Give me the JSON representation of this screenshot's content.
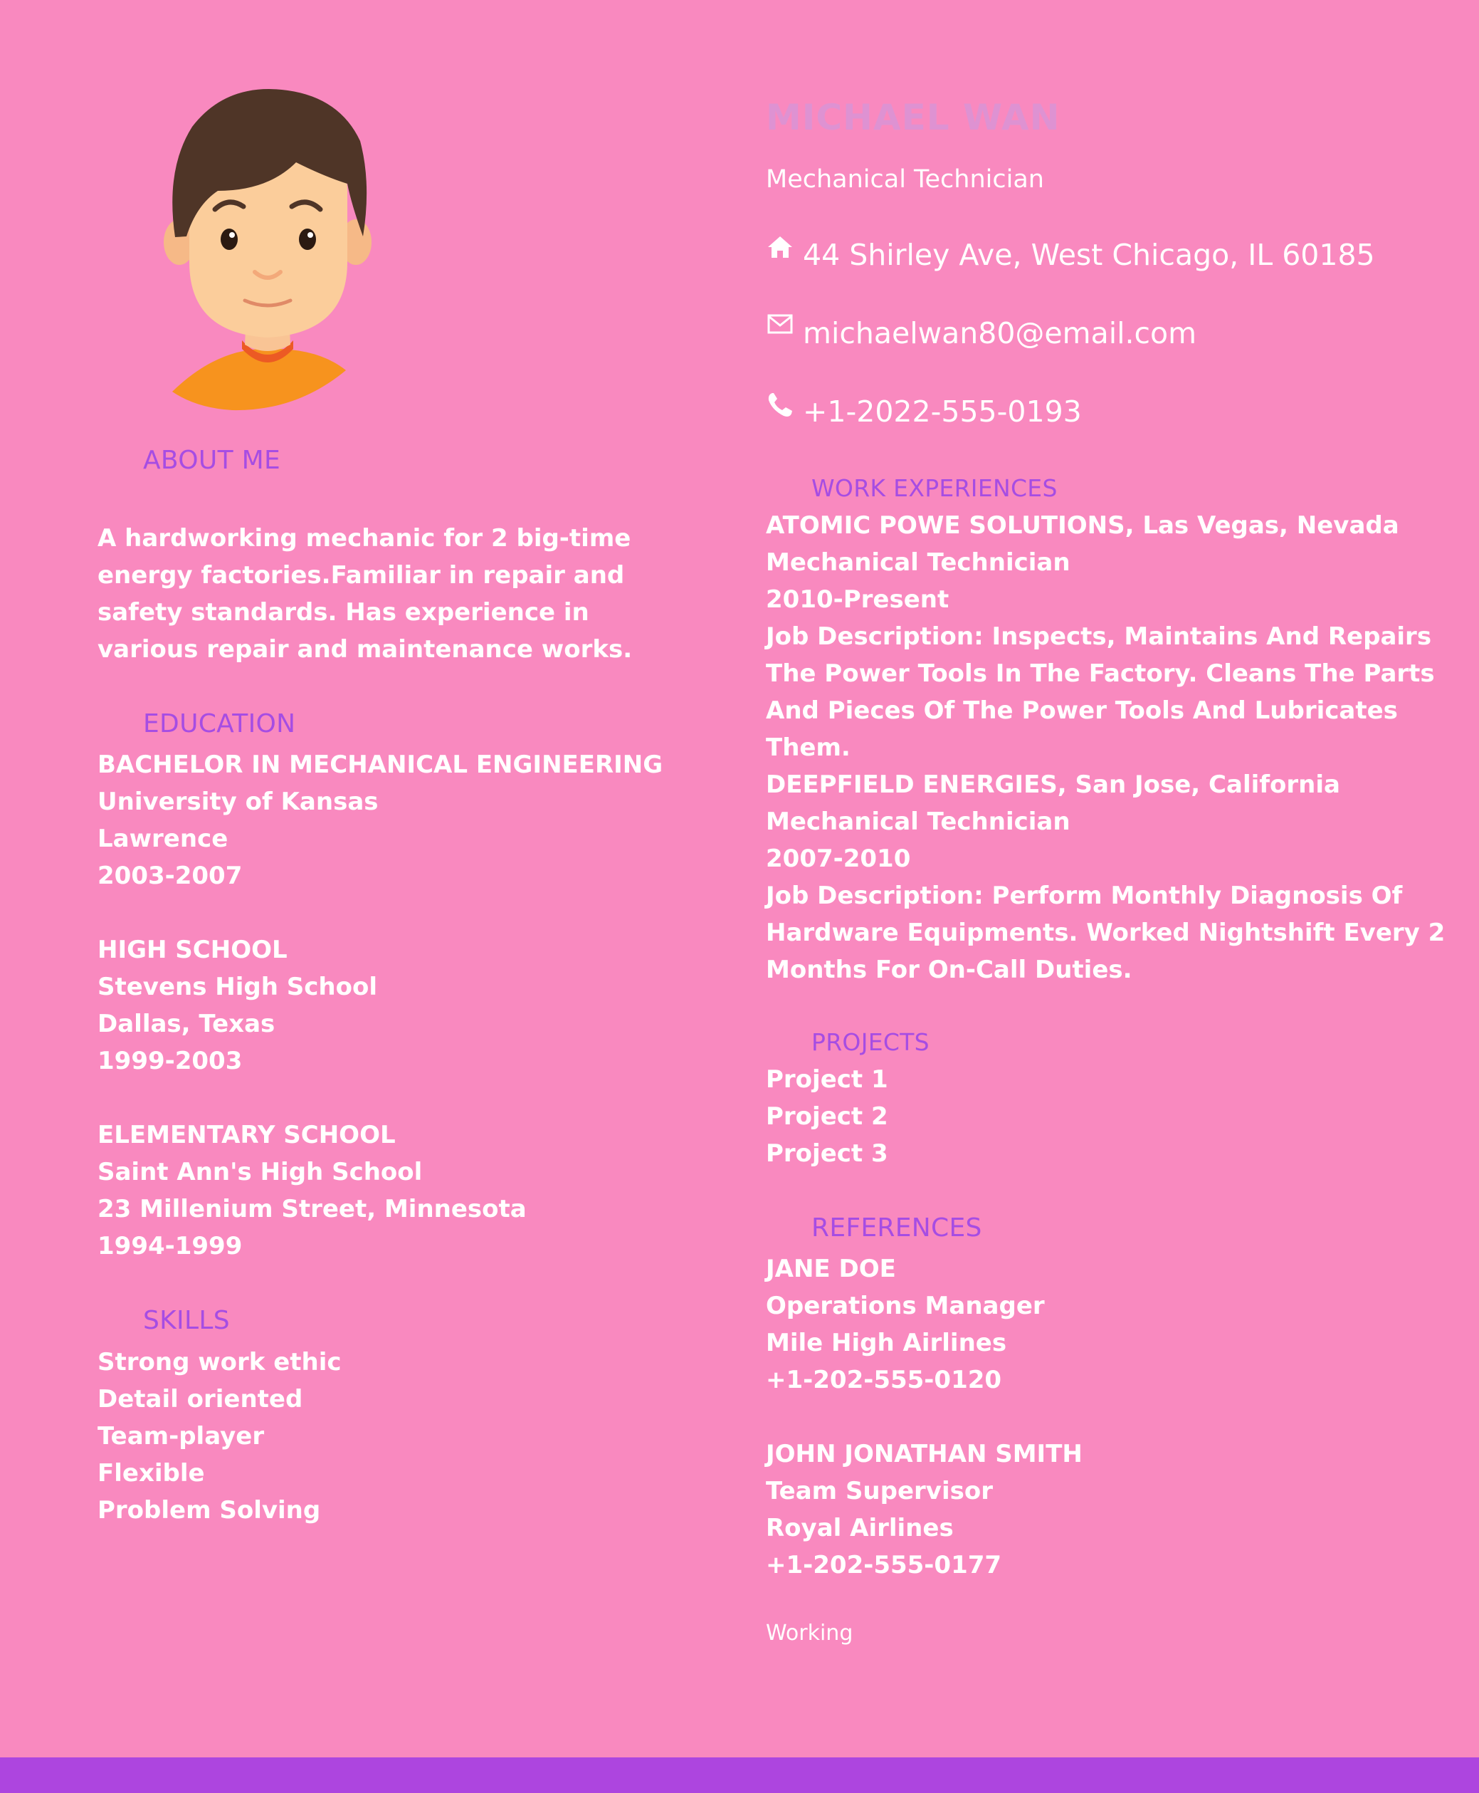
{
  "name": "MICHAEL WAN",
  "title": "Mechanical Technician",
  "contact": {
    "address": "44 Shirley Ave, West Chicago, IL 60185",
    "email": "michaelwan80@email.com",
    "phone": "+1-2022-555-0193",
    "address_icon": "home-icon",
    "email_icon": "envelope-icon",
    "phone_icon": "phone-icon"
  },
  "colors": {
    "background": "#f989bf",
    "accent": "#a64de3",
    "bottom_bar": "#ad45df",
    "text": "#ffffff"
  },
  "about": {
    "heading": "ABOUT ME",
    "text": "A hardworking mechanic for 2 big-time energy factories.Familiar in repair and safety standards. Has experience in various repair and maintenance works."
  },
  "education": {
    "heading": "EDUCATION",
    "entries": [
      {
        "degree": "BACHELOR IN MECHANICAL ENGINEERING",
        "school": "University of Kansas",
        "location": "Lawrence",
        "years": "2003-2007"
      },
      {
        "degree": "HIGH SCHOOL",
        "school": "Stevens High School",
        "location": "Dallas, Texas",
        "years": "1999-2003"
      },
      {
        "degree": "ELEMENTARY SCHOOL",
        "school": "Saint Ann's High School",
        "location": "23 Millenium Street, Minnesota",
        "years": "1994-1999"
      }
    ]
  },
  "skills": {
    "heading": "SKILLS",
    "items": [
      "Strong work ethic",
      "Detail oriented",
      "Team-player",
      "Flexible",
      "Problem Solving"
    ]
  },
  "work": {
    "heading": "WORK EXPERIENCES",
    "entries": [
      {
        "company": "ATOMIC POWE SOLUTIONS, Las Vegas, Nevada",
        "role": "Mechanical Technician",
        "years": "2010-Present",
        "description": "Job Description: Inspects, Maintains And Repairs The Power Tools In The Factory. Cleans The Parts And Pieces Of The Power Tools And Lubricates Them."
      },
      {
        "company": "DEEPFIELD ENERGIES, San Jose, California",
        "role": "Mechanical Technician",
        "years": "2007-2010",
        "description": "Job Description: Perform Monthly Diagnosis Of Hardware Equipments. Worked Nightshift Every 2 Months For On-Call Duties."
      }
    ]
  },
  "projects": {
    "heading": "PROJECTS",
    "items": [
      "Project 1",
      "Project 2",
      "Project 3"
    ]
  },
  "references": {
    "heading": "REFERENCES",
    "entries": [
      {
        "name": "JANE DOE",
        "position": "Operations Manager",
        "company": "Mile High Airlines",
        "phone": "+1-202-555-0120"
      },
      {
        "name": "JOHN JONATHAN SMITH",
        "position": "Team Supervisor",
        "company": "Royal Airlines",
        "phone": "+1-202-555-0177"
      }
    ]
  },
  "footer_note": "Working"
}
